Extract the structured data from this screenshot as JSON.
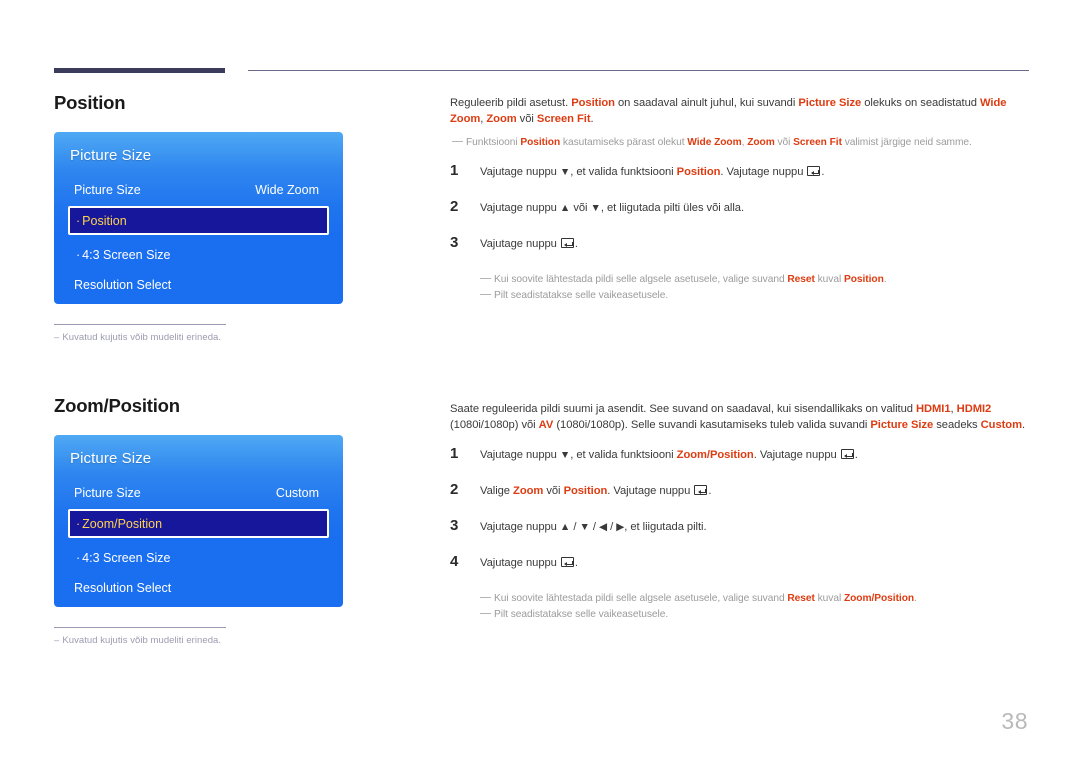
{
  "page": {
    "number": "38",
    "language": "et"
  },
  "sections": [
    {
      "heading": "Position",
      "osd": {
        "title": "Picture Size",
        "rows": [
          {
            "label": "Picture Size",
            "value": "Wide Zoom",
            "selected": false,
            "bullet": false
          },
          {
            "label": "Position",
            "value": "",
            "selected": true,
            "bullet": true
          },
          {
            "label": "4:3 Screen Size",
            "value": "",
            "selected": false,
            "bullet": true
          },
          {
            "label": "Resolution Select",
            "value": "",
            "selected": false,
            "bullet": false
          }
        ]
      },
      "caption": "Kuvatud kujutis võib mudeliti erineda.",
      "intro_parts": [
        {
          "t": "Reguleerib pildi asetust. ",
          "b": false
        },
        {
          "t": "Position",
          "b": true
        },
        {
          "t": " on saadaval ainult juhul, kui suvandi ",
          "b": false
        },
        {
          "t": "Picture Size",
          "b": true
        },
        {
          "t": " olekuks on seadistatud ",
          "b": false
        },
        {
          "t": "Wide Zoom",
          "b": true
        },
        {
          "t": ", ",
          "b": false
        },
        {
          "t": "Zoom",
          "b": true
        },
        {
          "t": " või ",
          "b": false
        },
        {
          "t": "Screen Fit",
          "b": true
        },
        {
          "t": ".",
          "b": false
        }
      ],
      "intro_note_parts": [
        {
          "t": "Funktsiooni ",
          "b": false
        },
        {
          "t": "Position",
          "b": true
        },
        {
          "t": " kasutamiseks pärast olekut ",
          "b": false
        },
        {
          "t": "Wide Zoom",
          "b": true
        },
        {
          "t": ", ",
          "b": false
        },
        {
          "t": "Zoom",
          "b": true
        },
        {
          "t": " või ",
          "b": false
        },
        {
          "t": "Screen Fit",
          "b": true
        },
        {
          "t": " valimist järgige neid samme.",
          "b": false
        }
      ],
      "steps": [
        {
          "num": "1",
          "parts": [
            {
              "t": "Vajutage nuppu ",
              "k": "text"
            },
            {
              "t": "▼",
              "k": "arrow"
            },
            {
              "t": ", et valida funktsiooni ",
              "k": "text"
            },
            {
              "t": "Position",
              "k": "accent"
            },
            {
              "t": ". Vajutage nuppu ",
              "k": "text"
            },
            {
              "t": "enter-key-icon",
              "k": "enter"
            },
            {
              "t": ".",
              "k": "text"
            }
          ]
        },
        {
          "num": "2",
          "parts": [
            {
              "t": "Vajutage nuppu ",
              "k": "text"
            },
            {
              "t": "▲",
              "k": "arrow"
            },
            {
              "t": " või ",
              "k": "text"
            },
            {
              "t": "▼",
              "k": "arrow"
            },
            {
              "t": ", et liigutada pilti üles või alla.",
              "k": "text"
            }
          ]
        },
        {
          "num": "3",
          "parts": [
            {
              "t": "Vajutage nuppu ",
              "k": "text"
            },
            {
              "t": "enter-key-icon",
              "k": "enter"
            },
            {
              "t": ".",
              "k": "text"
            }
          ]
        }
      ],
      "sub_notes": [
        [
          {
            "t": "Kui soovite lähtestada pildi selle algsele asetusele, valige suvand ",
            "b": false
          },
          {
            "t": "Reset",
            "b": true
          },
          {
            "t": " kuval ",
            "b": false
          },
          {
            "t": "Position",
            "b": true
          },
          {
            "t": ".",
            "b": false
          }
        ],
        [
          {
            "t": "Pilt seadistatakse selle vaikeasetusele.",
            "b": false
          }
        ]
      ]
    },
    {
      "heading": "Zoom/Position",
      "osd": {
        "title": "Picture Size",
        "rows": [
          {
            "label": "Picture Size",
            "value": "Custom",
            "selected": false,
            "bullet": false
          },
          {
            "label": "Zoom/Position",
            "value": "",
            "selected": true,
            "bullet": true
          },
          {
            "label": "4:3 Screen Size",
            "value": "",
            "selected": false,
            "bullet": true
          },
          {
            "label": "Resolution Select",
            "value": "",
            "selected": false,
            "bullet": false
          }
        ]
      },
      "caption": "Kuvatud kujutis võib mudeliti erineda.",
      "intro_parts": [
        {
          "t": "Saate reguleerida pildi suumi ja asendit. See suvand on saadaval, kui sisendallikaks on valitud ",
          "b": false
        },
        {
          "t": "HDMI1",
          "b": true
        },
        {
          "t": ", ",
          "b": false
        },
        {
          "t": "HDMI2",
          "b": true
        },
        {
          "t": " (1080i/1080p) või ",
          "b": false
        },
        {
          "t": "AV",
          "b": true
        },
        {
          "t": " (1080i/1080p). Selle suvandi kasutamiseks tuleb valida suvandi ",
          "b": false
        },
        {
          "t": "Picture Size",
          "b": true
        },
        {
          "t": " seadeks ",
          "b": false
        },
        {
          "t": "Custom",
          "b": true
        },
        {
          "t": ".",
          "b": false
        }
      ],
      "intro_note_parts": [],
      "steps": [
        {
          "num": "1",
          "parts": [
            {
              "t": "Vajutage nuppu ",
              "k": "text"
            },
            {
              "t": "▼",
              "k": "arrow"
            },
            {
              "t": ", et valida funktsiooni ",
              "k": "text"
            },
            {
              "t": "Zoom/Position",
              "k": "accent"
            },
            {
              "t": ". Vajutage nuppu ",
              "k": "text"
            },
            {
              "t": "enter-key-icon",
              "k": "enter"
            },
            {
              "t": ".",
              "k": "text"
            }
          ]
        },
        {
          "num": "2",
          "parts": [
            {
              "t": "Valige ",
              "k": "text"
            },
            {
              "t": "Zoom",
              "k": "accent"
            },
            {
              "t": " või ",
              "k": "text"
            },
            {
              "t": "Position",
              "k": "accent"
            },
            {
              "t": ". Vajutage nuppu ",
              "k": "text"
            },
            {
              "t": "enter-key-icon",
              "k": "enter"
            },
            {
              "t": ".",
              "k": "text"
            }
          ]
        },
        {
          "num": "3",
          "parts": [
            {
              "t": "Vajutage nuppu ",
              "k": "text"
            },
            {
              "t": "▲",
              "k": "arrow"
            },
            {
              "t": " / ",
              "k": "text"
            },
            {
              "t": "▼",
              "k": "arrow"
            },
            {
              "t": " / ",
              "k": "text"
            },
            {
              "t": "◀",
              "k": "arrow"
            },
            {
              "t": " / ",
              "k": "text"
            },
            {
              "t": "▶",
              "k": "arrow"
            },
            {
              "t": ", et liigutada pilti.",
              "k": "text"
            }
          ]
        },
        {
          "num": "4",
          "parts": [
            {
              "t": "Vajutage nuppu ",
              "k": "text"
            },
            {
              "t": "enter-key-icon",
              "k": "enter"
            },
            {
              "t": ".",
              "k": "text"
            }
          ]
        }
      ],
      "sub_notes": [
        [
          {
            "t": "Kui soovite lähtestada pildi selle algsele asetusele, valige suvand ",
            "b": false
          },
          {
            "t": "Reset",
            "b": true
          },
          {
            "t": " kuval ",
            "b": false
          },
          {
            "t": "Zoom/Position",
            "b": true
          },
          {
            "t": ".",
            "b": false
          }
        ],
        [
          {
            "t": "Pilt seadistatakse selle vaikeasetusele.",
            "b": false
          }
        ]
      ]
    }
  ],
  "colors": {
    "accent": "#dd3c12",
    "osd_blue_top": "#4fa9f3",
    "osd_blue_bottom": "#1a6ef0",
    "osd_selected_fill": "#17179b",
    "osd_selected_text": "#ffd34d",
    "rule_dark": "#3b3b5c",
    "note_gray": "#9b9b9b"
  }
}
